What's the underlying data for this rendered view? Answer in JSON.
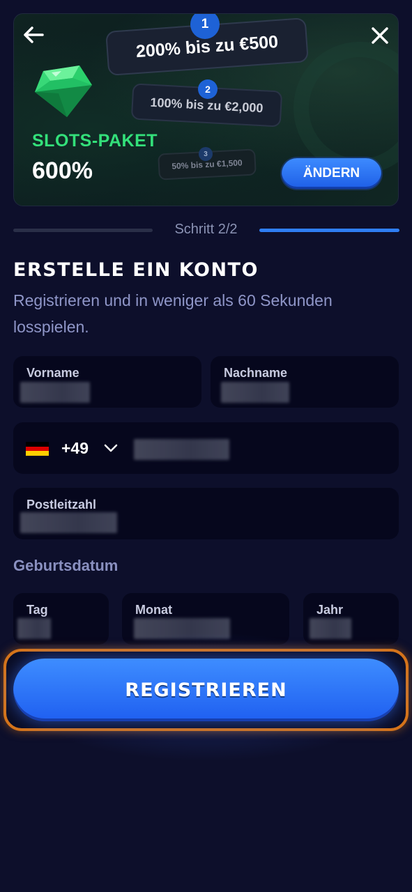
{
  "banner": {
    "step1": {
      "number": "1",
      "text": "200% bis zu €500"
    },
    "step2": {
      "number": "2",
      "text": "100% bis zu €2,000"
    },
    "step3": {
      "number": "3",
      "text": "50% bis zu €1,500"
    },
    "package_label": "SLOTS-PAKET",
    "package_value": "600%",
    "change_label": "ÄNDERN",
    "gem_icon": "emerald-gem-icon",
    "colors": {
      "package_label": "#33e07a",
      "badge": "#1e62d6"
    }
  },
  "progress": {
    "step_text": "Schritt 2/2",
    "completed_fraction": 1.0
  },
  "headline": "ERSTELLE EIN KONTO",
  "subline": "Registrieren und in weniger als 60 Sekunden losspielen.",
  "form": {
    "first_name_label": "Vorname",
    "last_name_label": "Nachname",
    "dial_code": "+49",
    "country_flag": "germany-flag-icon",
    "postal_code_label": "Postleitzahl",
    "birthdate_label": "Geburtsdatum",
    "day_label": "Tag",
    "month_label": "Monat",
    "year_label": "Jahr"
  },
  "cta": {
    "label": "REGISTRIEREN",
    "accent": "#2f7ef5",
    "frame": "#d6741a"
  }
}
